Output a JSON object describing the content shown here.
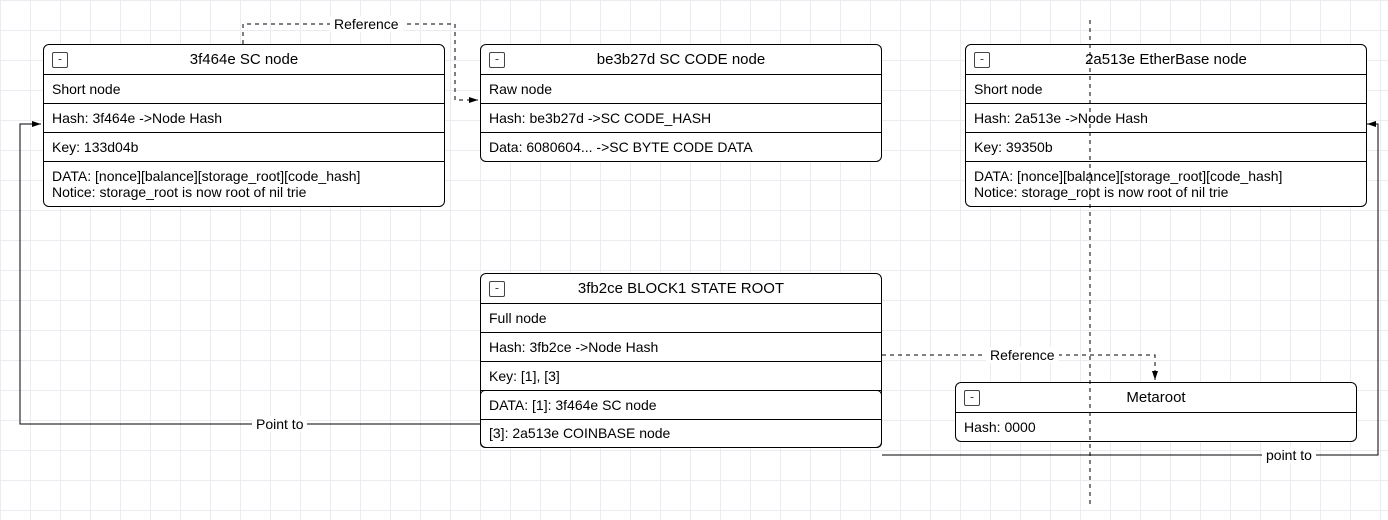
{
  "labels": {
    "reference1": "Reference",
    "reference2": "Reference",
    "point_to1": "Point to",
    "point_to2": "point to"
  },
  "nodes": {
    "sc": {
      "title": "3f464e  SC node",
      "type": "Short node",
      "hash": "Hash: 3f464e ->Node Hash",
      "key": "Key: 133d04b",
      "data": "DATA: [nonce][balance][storage_root][code_hash]\nNotice: storage_root is now root of nil trie"
    },
    "sccode": {
      "title": "be3b27d SC CODE node",
      "type": "Raw node",
      "hash": "Hash: be3b27d ->SC CODE_HASH",
      "data": "Data: 6080604... ->SC BYTE CODE DATA"
    },
    "ether": {
      "title": "2a513e  EtherBase node",
      "type": "Short node",
      "hash": "Hash: 2a513e ->Node Hash",
      "key": "Key: 39350b",
      "data": "DATA: [nonce][balance][storage_root][code_hash]\nNotice: storage_root is now root of nil trie"
    },
    "root": {
      "title": "3fb2ce  BLOCK1 STATE ROOT",
      "type": "Full node",
      "hash": "Hash: 3fb2ce ->Node Hash",
      "key": "Key: [1], [3]",
      "data1": "DATA: [1]: 3f464e  SC node",
      "data3": "         [3]: 2a513e  COINBASE node"
    },
    "metaroot": {
      "title": "Metaroot",
      "hash": "Hash: 0000"
    }
  }
}
